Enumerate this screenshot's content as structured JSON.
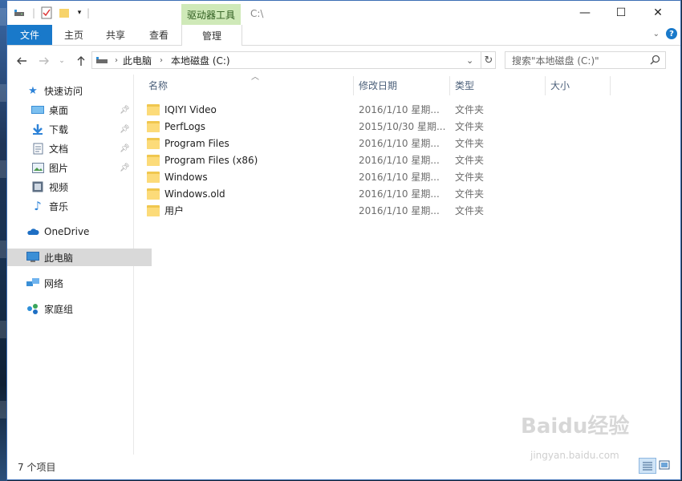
{
  "window": {
    "title_path": "C:\\",
    "context_tab": "驱动器工具",
    "controls": {
      "minimize": "—",
      "maximize": "☐",
      "close": "✕"
    }
  },
  "ribbon": {
    "tabs": [
      {
        "label": "文件",
        "active": true
      },
      {
        "label": "主页"
      },
      {
        "label": "共享"
      },
      {
        "label": "查看"
      },
      {
        "label": "管理"
      }
    ],
    "help_label": "?"
  },
  "address": {
    "crumbs": [
      "此电脑",
      "本地磁盘 (C:)"
    ]
  },
  "search": {
    "placeholder": "搜索\"本地磁盘 (C:)\""
  },
  "nav": {
    "quick_access": "快速访问",
    "items": [
      {
        "label": "桌面",
        "icon": "desktop-icon",
        "pinned": true
      },
      {
        "label": "下载",
        "icon": "download-icon",
        "pinned": true
      },
      {
        "label": "文档",
        "icon": "document-icon",
        "pinned": true
      },
      {
        "label": "图片",
        "icon": "picture-icon",
        "pinned": true
      },
      {
        "label": "视频",
        "icon": "video-icon",
        "pinned": false
      },
      {
        "label": "音乐",
        "icon": "music-icon",
        "pinned": false
      }
    ],
    "onedrive": "OneDrive",
    "this_pc": "此电脑",
    "network": "网络",
    "homegroup": "家庭组"
  },
  "columns": {
    "name": "名称",
    "date": "修改日期",
    "type": "类型",
    "size": "大小"
  },
  "files": [
    {
      "name": "IQIYI Video",
      "date": "2016/1/10 星期...",
      "type": "文件夹"
    },
    {
      "name": "PerfLogs",
      "date": "2015/10/30 星期...",
      "type": "文件夹"
    },
    {
      "name": "Program Files",
      "date": "2016/1/10 星期...",
      "type": "文件夹"
    },
    {
      "name": "Program Files (x86)",
      "date": "2016/1/10 星期...",
      "type": "文件夹"
    },
    {
      "name": "Windows",
      "date": "2016/1/10 星期...",
      "type": "文件夹"
    },
    {
      "name": "Windows.old",
      "date": "2016/1/10 星期...",
      "type": "文件夹"
    },
    {
      "name": "用户",
      "date": "2016/1/10 星期...",
      "type": "文件夹"
    }
  ],
  "status": {
    "count": "7 个项目"
  },
  "watermark": {
    "brand": "Baidu经验",
    "url": "jingyan.baidu.com"
  },
  "colors": {
    "accent": "#1979ca",
    "context_tab": "#cfe9b8",
    "folder": "#f0c74f",
    "selection": "#d9d9d9"
  }
}
